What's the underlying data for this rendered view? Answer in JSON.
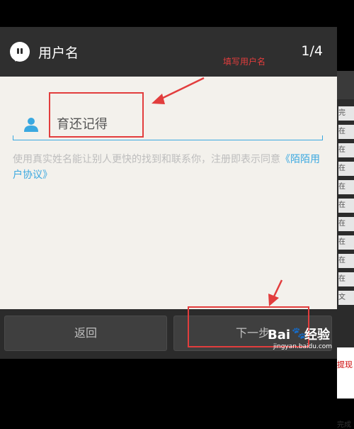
{
  "dialog": {
    "title": "用户名",
    "step": "1/4",
    "input_value": "育还记得",
    "hint_text": "使用真实姓名能让别人更快的找到和联系你，注册即表示同意",
    "hint_link": "《陌陌用户协议》",
    "back_label": "返回",
    "next_label": "下一步"
  },
  "annotation": {
    "label": "填写用户名",
    "color": "#e23d3d"
  },
  "background_panel": {
    "rows": [
      "完",
      "在",
      "在",
      "在",
      "在",
      "在",
      "在",
      "在",
      "在",
      "在",
      "文"
    ],
    "red_label": "提现",
    "done_label": "完成"
  },
  "watermark": {
    "main": "Bai",
    "main_suffix": "经验",
    "sub": "jingyan.baidu.com"
  },
  "colors": {
    "accent": "#3aa8e0",
    "header_bg": "#2f2f2f",
    "dialog_bg": "#f3f1ec"
  }
}
